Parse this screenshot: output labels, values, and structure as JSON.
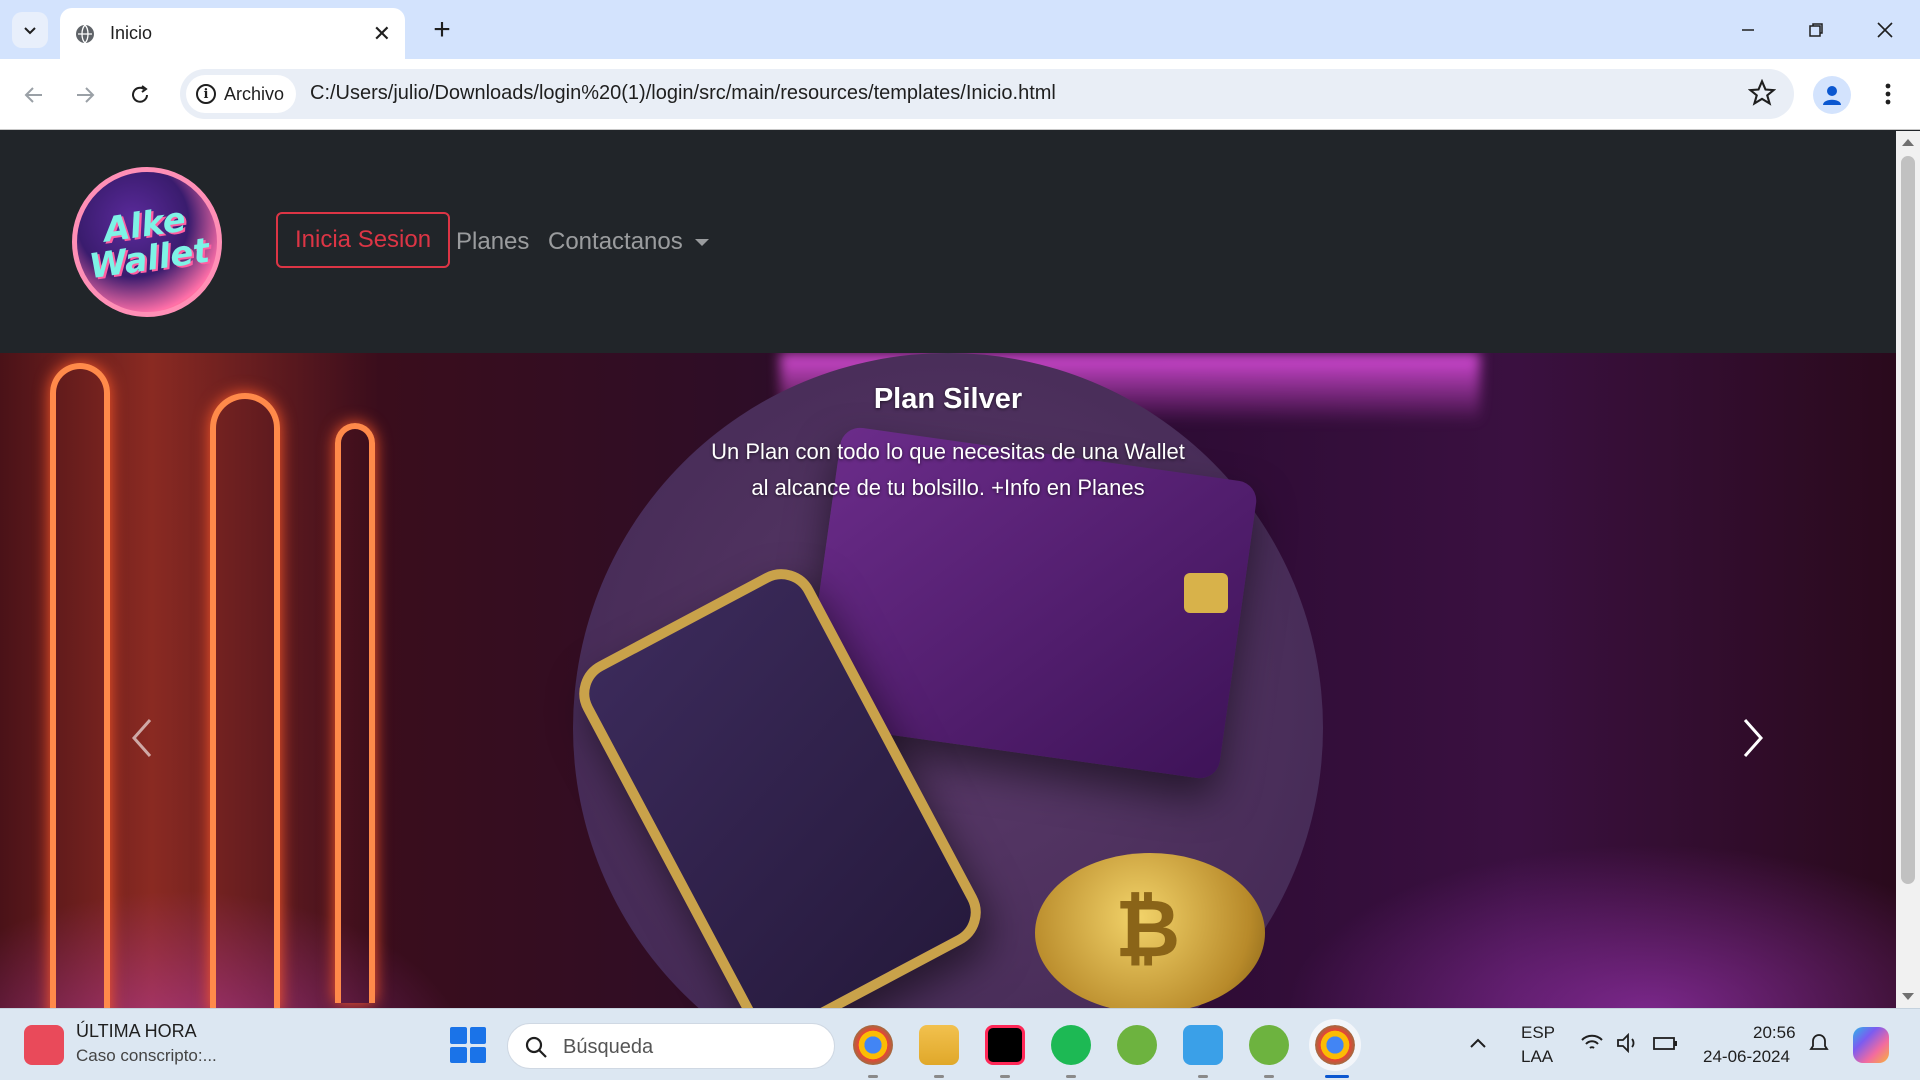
{
  "browser": {
    "tab_title": "Inicio",
    "chip_label": "Archivo",
    "url": "C:/Users/julio/Downloads/login%20(1)/login/src/main/resources/templates/Inicio.html"
  },
  "navbar": {
    "logo_text": "Alke Wallet",
    "login_button": "Inicia Sesion",
    "links": [
      "Planes",
      "Contactanos"
    ]
  },
  "carousel": {
    "title": "Plan Silver",
    "text_line1": "Un Plan con todo lo que necesitas de una Wallet",
    "text_line2": "al alcance de tu bolsillo. +Info en Planes"
  },
  "taskbar": {
    "news_title": "ÚLTIMA HORA",
    "news_subtitle": "Caso conscripto:...",
    "search_placeholder": "Búsqueda",
    "lang_top": "ESP",
    "lang_bottom": "LAA",
    "time": "20:56",
    "date": "24-06-2024"
  },
  "colors": {
    "navbar_bg": "#212529",
    "login_accent": "#dc3545",
    "tabstrip_bg": "#d3e3fd"
  }
}
